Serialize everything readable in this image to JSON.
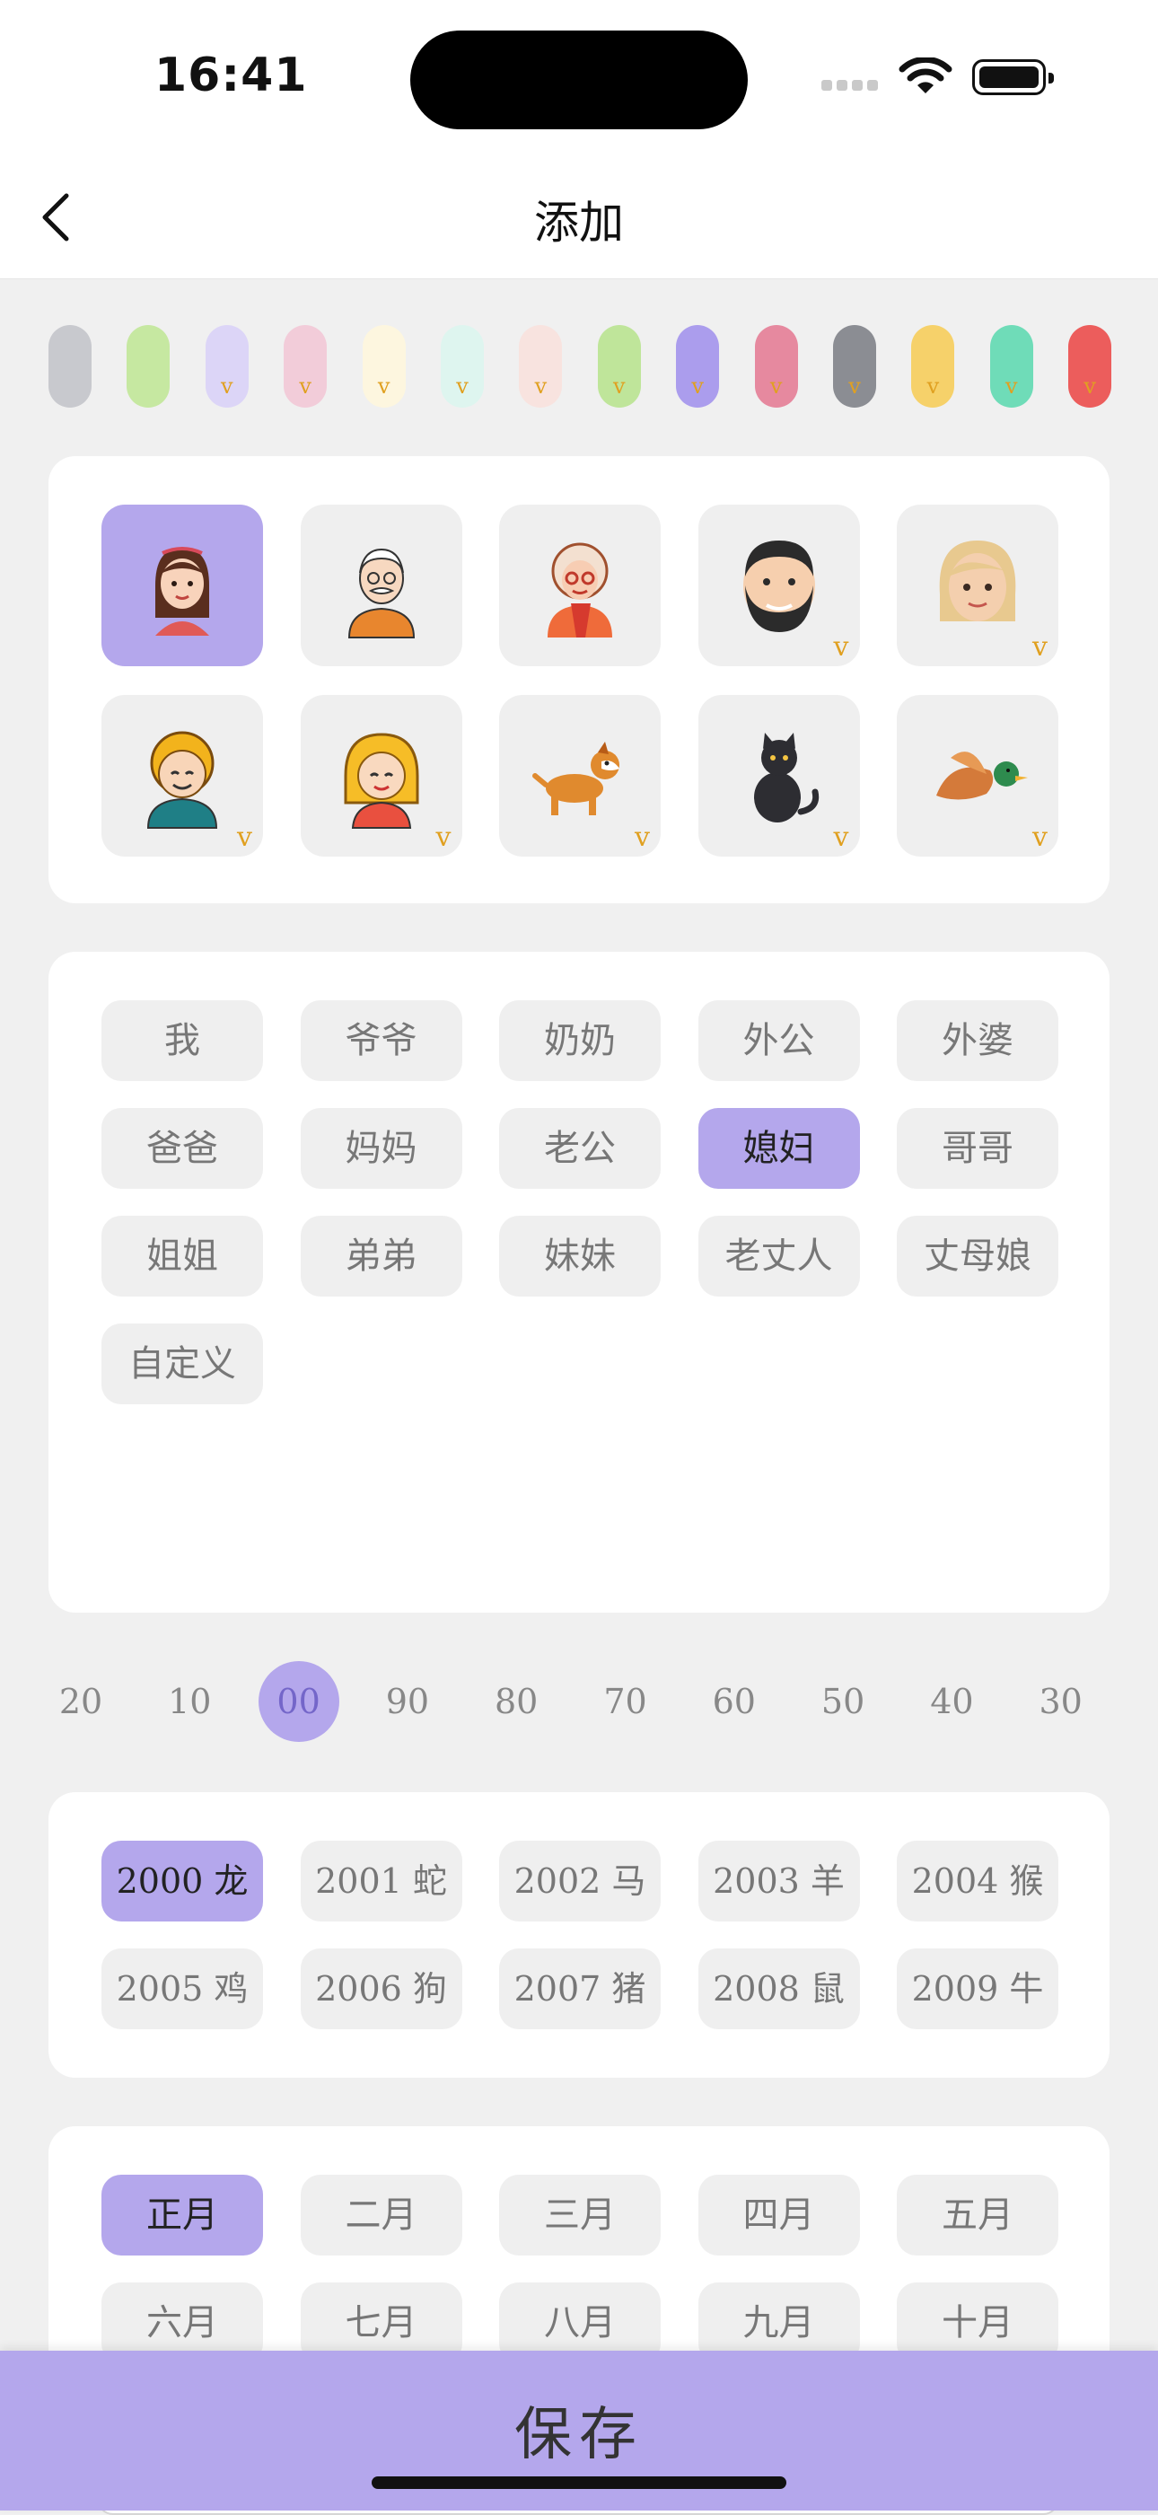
{
  "status": {
    "time": "16:41"
  },
  "nav": {
    "title": "添加"
  },
  "color_swatches": [
    {
      "color": "#c8c9ce",
      "premium": false
    },
    {
      "color": "#c6e8a1",
      "premium": false
    },
    {
      "color": "#dcd5f7",
      "premium": true,
      "badge": "v"
    },
    {
      "color": "#f2ccd9",
      "premium": true,
      "badge": "v"
    },
    {
      "color": "#fdf6df",
      "premium": true,
      "badge": "v"
    },
    {
      "color": "#def5ef",
      "premium": true,
      "badge": "v"
    },
    {
      "color": "#f8e3df",
      "premium": true,
      "badge": "v"
    },
    {
      "color": "#bfe59a",
      "premium": true,
      "badge": "v"
    },
    {
      "color": "#ab9ded",
      "premium": true,
      "badge": "v"
    },
    {
      "color": "#e6899f",
      "premium": true,
      "badge": "v"
    },
    {
      "color": "#8b8d93",
      "premium": true,
      "badge": "v"
    },
    {
      "color": "#f6d16a",
      "premium": true,
      "badge": "v"
    },
    {
      "color": "#6fdcb8",
      "premium": true,
      "badge": "v"
    },
    {
      "color": "#ec5d5c",
      "premium": true,
      "badge": "v"
    }
  ],
  "avatars": [
    {
      "name": "girl-avatar",
      "selected": true,
      "premium": false
    },
    {
      "name": "grandpa-avatar",
      "selected": false,
      "premium": false
    },
    {
      "name": "grandma-avatar",
      "selected": false,
      "premium": false
    },
    {
      "name": "bearded-man-avatar",
      "selected": false,
      "premium": true,
      "badge": "v"
    },
    {
      "name": "blonde-woman-avatar",
      "selected": false,
      "premium": true,
      "badge": "v"
    },
    {
      "name": "curly-boy-avatar",
      "selected": false,
      "premium": true,
      "badge": "v"
    },
    {
      "name": "blonde-girl-avatar",
      "selected": false,
      "premium": true,
      "badge": "v"
    },
    {
      "name": "dog-avatar",
      "selected": false,
      "premium": true,
      "badge": "v"
    },
    {
      "name": "cat-avatar",
      "selected": false,
      "premium": true,
      "badge": "v"
    },
    {
      "name": "duck-avatar",
      "selected": false,
      "premium": true,
      "badge": "v"
    }
  ],
  "relations": [
    "我",
    "爷爷",
    "奶奶",
    "外公",
    "外婆",
    "爸爸",
    "妈妈",
    "老公",
    "媳妇",
    "哥哥",
    "姐姐",
    "弟弟",
    "妹妹",
    "老丈人",
    "丈母娘",
    "自定义"
  ],
  "relation_selected": "媳妇",
  "name_input": {
    "value": "媳妇"
  },
  "decades": [
    "20",
    "10",
    "00",
    "90",
    "80",
    "70",
    "60",
    "50",
    "40",
    "30"
  ],
  "decade_selected": "00",
  "years": [
    "2000 龙",
    "2001 蛇",
    "2002 马",
    "2003 羊",
    "2004 猴",
    "2005 鸡",
    "2006 狗",
    "2007 猪",
    "2008 鼠",
    "2009 牛"
  ],
  "year_selected": "2000 龙",
  "months": [
    "正月",
    "二月",
    "三月",
    "四月",
    "五月",
    "六月",
    "七月",
    "八月",
    "九月",
    "十月"
  ],
  "month_selected": "正月",
  "save_label": "保存",
  "colors": {
    "accent": "#b4a7ec",
    "premium_badge": "#e0a020",
    "chip_bg": "#efefef"
  }
}
